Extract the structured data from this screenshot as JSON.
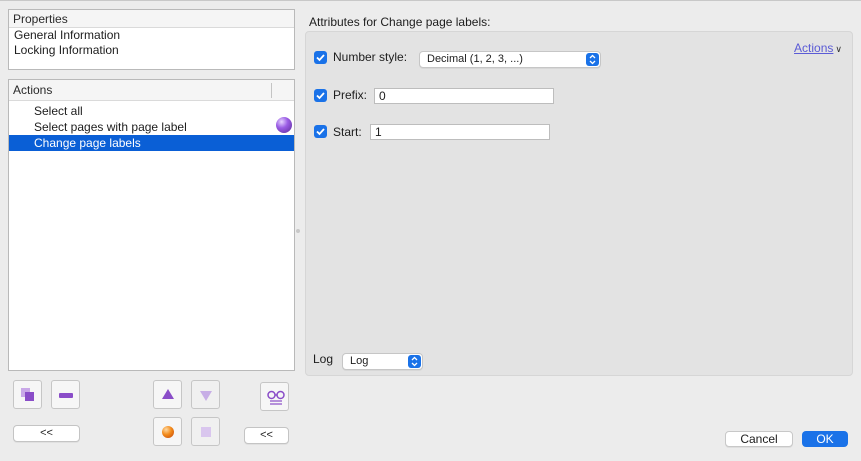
{
  "properties": {
    "header": "Properties",
    "items": [
      "General Information",
      "Locking Information"
    ]
  },
  "actions_panel": {
    "header": "Actions",
    "items": [
      {
        "label": "Select all",
        "selected": false
      },
      {
        "label": "Select pages with page label",
        "selected": false
      },
      {
        "label": "Change page labels",
        "selected": true
      }
    ],
    "item_icon": "purple-ball-icon"
  },
  "toolbar": {
    "collapse_left_label": "<<",
    "collapse_right_label": "<<",
    "icons": [
      "duplicate-icon",
      "remove-icon",
      "move-up-icon",
      "move-down-icon",
      "run-icon",
      "stop-icon",
      "inspect-icon"
    ]
  },
  "attributes": {
    "title": "Attributes for Change page labels:",
    "actions_link": "Actions",
    "number_style": {
      "label": "Number style:",
      "checked": true,
      "value": "Decimal (1, 2, 3, ...)"
    },
    "prefix": {
      "label": "Prefix:",
      "checked": true,
      "value": "0"
    },
    "start": {
      "label": "Start:",
      "checked": true,
      "value": "1"
    },
    "log": {
      "label": "Log",
      "value": "Log"
    }
  },
  "dialog": {
    "cancel_label": "Cancel",
    "ok_label": "OK"
  },
  "colors": {
    "accent": "#1a72e8",
    "selection": "#0a5fd6",
    "link": "#5b5bd6",
    "icon_purple": "#8a4dc8"
  }
}
